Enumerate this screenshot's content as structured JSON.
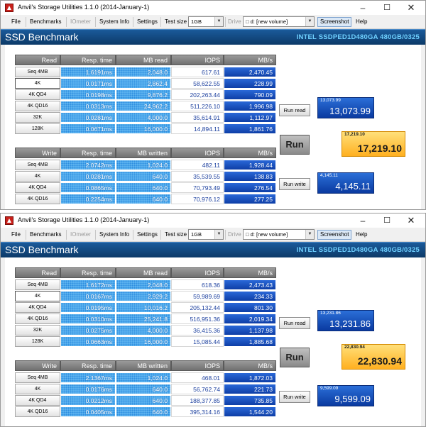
{
  "windows": [
    {
      "title": "Anvil's Storage Utilities 1.1.0 (2014-January-1)",
      "menu": {
        "file": "File",
        "benchmarks": "Benchmarks",
        "iometer": "IOmeter",
        "system_info": "System Info",
        "settings": "Settings",
        "test_size_label": "Test size",
        "test_size_value": "1GB",
        "drive_label": "Drive",
        "drive_value": "d: [new volume]",
        "screenshot": "Screenshot",
        "help": "Help"
      },
      "header": {
        "title": "SSD Benchmark",
        "model": "INTEL SSDPED1D480GA 480GB/0325"
      },
      "read_headers": {
        "section": "Read",
        "resp": "Resp. time",
        "mb": "MB read",
        "iops": "IOPS",
        "mbs": "MB/s"
      },
      "read_rows": [
        {
          "label": "Seq 4MB",
          "resp": "1.6191ms",
          "mb": "2,048.0",
          "iops": "617.61",
          "mbs": "2,470.45"
        },
        {
          "label": "4K",
          "resp": "0.0171ms",
          "mb": "2,862.4",
          "iops": "58,622.55",
          "mbs": "228.99"
        },
        {
          "label": "4K QD4",
          "resp": "0.0198ms",
          "mb": "9,876.2",
          "iops": "202,263.44",
          "mbs": "790.09"
        },
        {
          "label": "4K QD16",
          "resp": "0.0313ms",
          "mb": "24,962.2",
          "iops": "511,226.10",
          "mbs": "1,996.98"
        },
        {
          "label": "32K",
          "resp": "0.0281ms",
          "mb": "4,000.0",
          "iops": "35,614.91",
          "mbs": "1,112.97"
        },
        {
          "label": "128K",
          "resp": "0.0671ms",
          "mb": "16,000.0",
          "iops": "14,894.11",
          "mbs": "1,861.76"
        }
      ],
      "write_headers": {
        "section": "Write",
        "resp": "Resp. time",
        "mb": "MB written",
        "iops": "IOPS",
        "mbs": "MB/s"
      },
      "write_rows": [
        {
          "label": "Seq 4MB",
          "resp": "2.0742ms",
          "mb": "1,024.0",
          "iops": "482.11",
          "mbs": "1,928.44"
        },
        {
          "label": "4K",
          "resp": "0.0281ms",
          "mb": "640.0",
          "iops": "35,539.55",
          "mbs": "138.83"
        },
        {
          "label": "4K QD4",
          "resp": "0.0865ms",
          "mb": "640.0",
          "iops": "70,793.49",
          "mbs": "276.54"
        },
        {
          "label": "4K QD16",
          "resp": "0.2254ms",
          "mb": "640.0",
          "iops": "70,976.12",
          "mbs": "277.25"
        }
      ],
      "buttons": {
        "run_read": "Run read",
        "run": "Run",
        "run_write": "Run write"
      },
      "scores": {
        "read_small": "13,073.99",
        "read_big": "13,073.99",
        "total_small": "17,219.10",
        "total_big": "17,219.10",
        "write_small": "4,145.11",
        "write_big": "4,145.11"
      }
    },
    {
      "title": "Anvil's Storage Utilities 1.1.0 (2014-January-1)",
      "menu": {
        "file": "File",
        "benchmarks": "Benchmarks",
        "iometer": "IOmeter",
        "system_info": "System Info",
        "settings": "Settings",
        "test_size_label": "Test size",
        "test_size_value": "1GB",
        "drive_label": "Drive",
        "drive_value": "d: [new volume]",
        "screenshot": "Screenshot",
        "help": "Help"
      },
      "header": {
        "title": "SSD Benchmark",
        "model": "INTEL SSDPED1D480GA 480GB/0325"
      },
      "read_headers": {
        "section": "Read",
        "resp": "Resp. time",
        "mb": "MB read",
        "iops": "IOPS",
        "mbs": "MB/s"
      },
      "read_rows": [
        {
          "label": "Seq 4MB",
          "resp": "1.6172ms",
          "mb": "2,048.0",
          "iops": "618.36",
          "mbs": "2,473.43"
        },
        {
          "label": "4K",
          "resp": "0.0167ms",
          "mb": "2,929.2",
          "iops": "59,989.69",
          "mbs": "234.33"
        },
        {
          "label": "4K QD4",
          "resp": "0.0195ms",
          "mb": "10,016.2",
          "iops": "205,132.44",
          "mbs": "801.30"
        },
        {
          "label": "4K QD16",
          "resp": "0.0310ms",
          "mb": "25,241.8",
          "iops": "516,951.36",
          "mbs": "2,019.34"
        },
        {
          "label": "32K",
          "resp": "0.0275ms",
          "mb": "4,000.0",
          "iops": "36,415.36",
          "mbs": "1,137.98"
        },
        {
          "label": "128K",
          "resp": "0.0663ms",
          "mb": "16,000.0",
          "iops": "15,085.44",
          "mbs": "1,885.68"
        }
      ],
      "write_headers": {
        "section": "Write",
        "resp": "Resp. time",
        "mb": "MB written",
        "iops": "IOPS",
        "mbs": "MB/s"
      },
      "write_rows": [
        {
          "label": "Seq 4MB",
          "resp": "2.1367ms",
          "mb": "1,024.0",
          "iops": "468.01",
          "mbs": "1,872.03"
        },
        {
          "label": "4K",
          "resp": "0.0176ms",
          "mb": "640.0",
          "iops": "56,762.74",
          "mbs": "221.73"
        },
        {
          "label": "4K QD4",
          "resp": "0.0212ms",
          "mb": "640.0",
          "iops": "188,377.85",
          "mbs": "735.85"
        },
        {
          "label": "4K QD16",
          "resp": "0.0405ms",
          "mb": "640.0",
          "iops": "395,314.16",
          "mbs": "1,544.20"
        }
      ],
      "buttons": {
        "run_read": "Run read",
        "run": "Run",
        "run_write": "Run write"
      },
      "scores": {
        "read_small": "13,231.86",
        "read_big": "13,231.86",
        "total_small": "22,830.94",
        "total_big": "22,830.94",
        "write_small": "9,599.09",
        "write_big": "9,599.09"
      }
    }
  ]
}
